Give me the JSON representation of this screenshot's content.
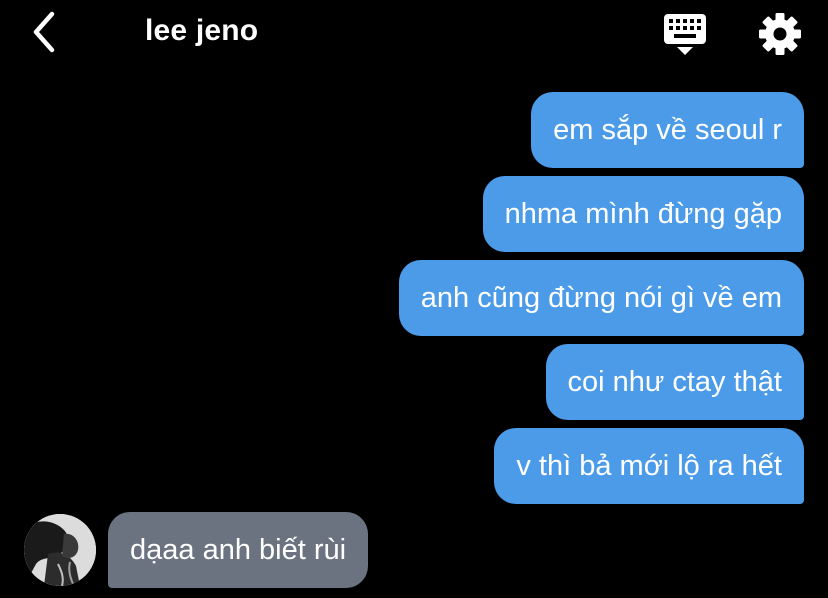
{
  "header": {
    "title": "lee jeno",
    "back_icon": "chevron-left-icon",
    "keyboard_icon": "keyboard-icon",
    "settings_icon": "gear-icon"
  },
  "messages": [
    {
      "direction": "sent",
      "text": "em sắp về seoul r"
    },
    {
      "direction": "sent",
      "text": "nhma mình đừng gặp"
    },
    {
      "direction": "sent",
      "text": "anh cũng đừng nói gì về em"
    },
    {
      "direction": "sent",
      "text": "coi như ctay thật"
    },
    {
      "direction": "sent",
      "text": "v thì bả mới lộ ra hết"
    },
    {
      "direction": "received",
      "text": "dạaa anh biết rùi"
    }
  ],
  "colors": {
    "background": "#000000",
    "sent_bubble": "#4c9be8",
    "received_bubble": "#6b7380",
    "text": "#ffffff"
  }
}
